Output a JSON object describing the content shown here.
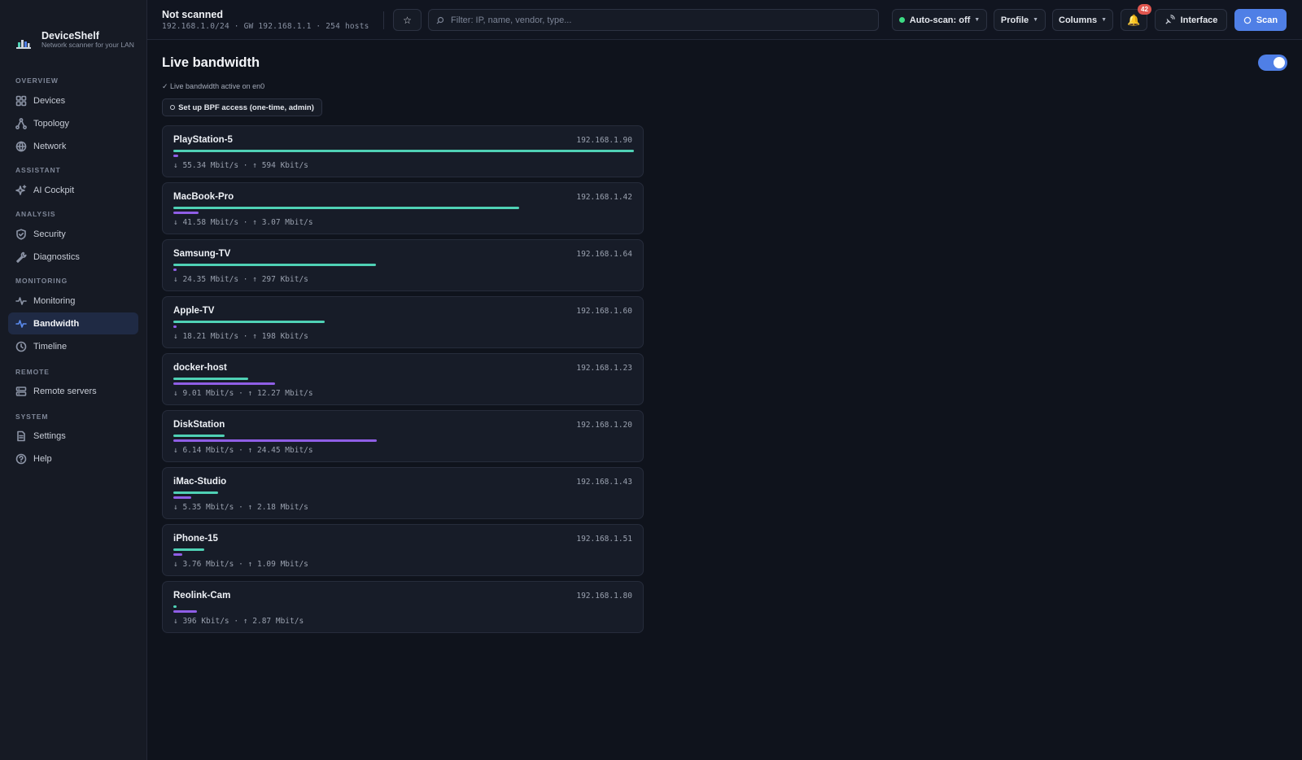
{
  "app": {
    "name": "DeviceShelf",
    "tagline": "Network scanner for your LAN"
  },
  "sidebar": {
    "sections": [
      {
        "title": "OVERVIEW",
        "items": [
          {
            "label": "Devices",
            "icon": "grid-icon"
          },
          {
            "label": "Topology",
            "icon": "topology-icon"
          },
          {
            "label": "Network",
            "icon": "globe-icon"
          }
        ]
      },
      {
        "title": "ASSISTANT",
        "items": [
          {
            "label": "AI Cockpit",
            "icon": "sparkle-icon"
          }
        ]
      },
      {
        "title": "ANALYSIS",
        "items": [
          {
            "label": "Security",
            "icon": "shield-icon"
          },
          {
            "label": "Diagnostics",
            "icon": "wrench-icon"
          }
        ]
      },
      {
        "title": "MONITORING",
        "items": [
          {
            "label": "Monitoring",
            "icon": "pulse-icon"
          },
          {
            "label": "Bandwidth",
            "icon": "pulse-icon",
            "active": true
          },
          {
            "label": "Timeline",
            "icon": "clock-icon"
          }
        ]
      },
      {
        "title": "REMOTE",
        "items": [
          {
            "label": "Remote servers",
            "icon": "server-icon"
          }
        ]
      },
      {
        "title": "SYSTEM",
        "items": [
          {
            "label": "Settings",
            "icon": "document-icon"
          },
          {
            "label": "Help",
            "icon": "help-icon"
          }
        ]
      }
    ]
  },
  "topbar": {
    "status_title": "Not scanned",
    "status_sub": "192.168.1.0/24 · GW 192.168.1.1 · 254 hosts",
    "search_placeholder": "Filter: IP, name, vendor, type...",
    "auto_scan_label": "Auto-scan: off",
    "profile_label": "Profile",
    "columns_label": "Columns",
    "notification_count": "42",
    "interface_label": "Interface",
    "scan_label": "Scan",
    "status_dot_color": "#3ddc84",
    "accent_color": "#4f7fe6"
  },
  "main": {
    "title": "Live bandwidth",
    "toggle_on": true,
    "active_note": "✓ Live bandwidth active on en0",
    "bpf_button": "Set up BPF access (one-time, admin)",
    "max_rate_mbit": 55.34,
    "colors": {
      "download": "#4fd1b5",
      "upload": "#8f5ee6"
    },
    "devices": [
      {
        "name": "PlayStation-5",
        "ip": "192.168.1.90",
        "down_text": "↓ 55.34 Mbit/s",
        "up_text": "↑ 594 Kbit/s",
        "down_mbit": 55.34,
        "up_mbit": 0.594
      },
      {
        "name": "MacBook-Pro",
        "ip": "192.168.1.42",
        "down_text": "↓ 41.58 Mbit/s",
        "up_text": "↑ 3.07 Mbit/s",
        "down_mbit": 41.58,
        "up_mbit": 3.07
      },
      {
        "name": "Samsung-TV",
        "ip": "192.168.1.64",
        "down_text": "↓ 24.35 Mbit/s",
        "up_text": "↑ 297 Kbit/s",
        "down_mbit": 24.35,
        "up_mbit": 0.297
      },
      {
        "name": "Apple-TV",
        "ip": "192.168.1.60",
        "down_text": "↓ 18.21 Mbit/s",
        "up_text": "↑ 198 Kbit/s",
        "down_mbit": 18.21,
        "up_mbit": 0.198
      },
      {
        "name": "docker-host",
        "ip": "192.168.1.23",
        "down_text": "↓ 9.01 Mbit/s",
        "up_text": "↑ 12.27 Mbit/s",
        "down_mbit": 9.01,
        "up_mbit": 12.27
      },
      {
        "name": "DiskStation",
        "ip": "192.168.1.20",
        "down_text": "↓ 6.14 Mbit/s",
        "up_text": "↑ 24.45 Mbit/s",
        "down_mbit": 6.14,
        "up_mbit": 24.45
      },
      {
        "name": "iMac-Studio",
        "ip": "192.168.1.43",
        "down_text": "↓ 5.35 Mbit/s",
        "up_text": "↑ 2.18 Mbit/s",
        "down_mbit": 5.35,
        "up_mbit": 2.18
      },
      {
        "name": "iPhone-15",
        "ip": "192.168.1.51",
        "down_text": "↓ 3.76 Mbit/s",
        "up_text": "↑ 1.09 Mbit/s",
        "down_mbit": 3.76,
        "up_mbit": 1.09
      },
      {
        "name": "Reolink-Cam",
        "ip": "192.168.1.80",
        "down_text": "↓ 396 Kbit/s",
        "up_text": "↑ 2.87 Mbit/s",
        "down_mbit": 0.396,
        "up_mbit": 2.87
      }
    ]
  }
}
